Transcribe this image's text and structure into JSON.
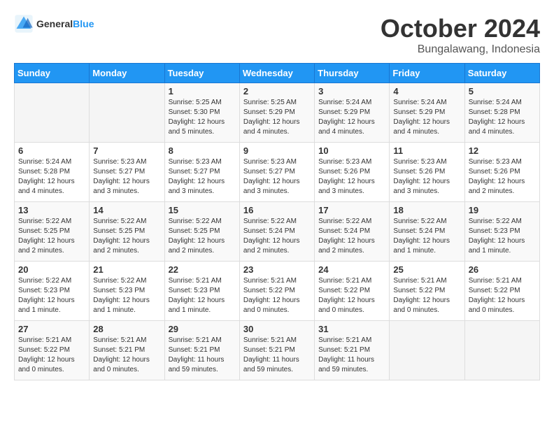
{
  "header": {
    "logo_general": "General",
    "logo_blue": "Blue",
    "month_title": "October 2024",
    "location": "Bungalawang, Indonesia"
  },
  "calendar": {
    "days_of_week": [
      "Sunday",
      "Monday",
      "Tuesday",
      "Wednesday",
      "Thursday",
      "Friday",
      "Saturday"
    ],
    "weeks": [
      [
        {
          "day": "",
          "content": ""
        },
        {
          "day": "",
          "content": ""
        },
        {
          "day": "1",
          "content": "Sunrise: 5:25 AM\nSunset: 5:30 PM\nDaylight: 12 hours\nand 5 minutes."
        },
        {
          "day": "2",
          "content": "Sunrise: 5:25 AM\nSunset: 5:29 PM\nDaylight: 12 hours\nand 4 minutes."
        },
        {
          "day": "3",
          "content": "Sunrise: 5:24 AM\nSunset: 5:29 PM\nDaylight: 12 hours\nand 4 minutes."
        },
        {
          "day": "4",
          "content": "Sunrise: 5:24 AM\nSunset: 5:29 PM\nDaylight: 12 hours\nand 4 minutes."
        },
        {
          "day": "5",
          "content": "Sunrise: 5:24 AM\nSunset: 5:28 PM\nDaylight: 12 hours\nand 4 minutes."
        }
      ],
      [
        {
          "day": "6",
          "content": "Sunrise: 5:24 AM\nSunset: 5:28 PM\nDaylight: 12 hours\nand 4 minutes."
        },
        {
          "day": "7",
          "content": "Sunrise: 5:23 AM\nSunset: 5:27 PM\nDaylight: 12 hours\nand 3 minutes."
        },
        {
          "day": "8",
          "content": "Sunrise: 5:23 AM\nSunset: 5:27 PM\nDaylight: 12 hours\nand 3 minutes."
        },
        {
          "day": "9",
          "content": "Sunrise: 5:23 AM\nSunset: 5:27 PM\nDaylight: 12 hours\nand 3 minutes."
        },
        {
          "day": "10",
          "content": "Sunrise: 5:23 AM\nSunset: 5:26 PM\nDaylight: 12 hours\nand 3 minutes."
        },
        {
          "day": "11",
          "content": "Sunrise: 5:23 AM\nSunset: 5:26 PM\nDaylight: 12 hours\nand 3 minutes."
        },
        {
          "day": "12",
          "content": "Sunrise: 5:23 AM\nSunset: 5:26 PM\nDaylight: 12 hours\nand 2 minutes."
        }
      ],
      [
        {
          "day": "13",
          "content": "Sunrise: 5:22 AM\nSunset: 5:25 PM\nDaylight: 12 hours\nand 2 minutes."
        },
        {
          "day": "14",
          "content": "Sunrise: 5:22 AM\nSunset: 5:25 PM\nDaylight: 12 hours\nand 2 minutes."
        },
        {
          "day": "15",
          "content": "Sunrise: 5:22 AM\nSunset: 5:25 PM\nDaylight: 12 hours\nand 2 minutes."
        },
        {
          "day": "16",
          "content": "Sunrise: 5:22 AM\nSunset: 5:24 PM\nDaylight: 12 hours\nand 2 minutes."
        },
        {
          "day": "17",
          "content": "Sunrise: 5:22 AM\nSunset: 5:24 PM\nDaylight: 12 hours\nand 2 minutes."
        },
        {
          "day": "18",
          "content": "Sunrise: 5:22 AM\nSunset: 5:24 PM\nDaylight: 12 hours\nand 1 minute."
        },
        {
          "day": "19",
          "content": "Sunrise: 5:22 AM\nSunset: 5:23 PM\nDaylight: 12 hours\nand 1 minute."
        }
      ],
      [
        {
          "day": "20",
          "content": "Sunrise: 5:22 AM\nSunset: 5:23 PM\nDaylight: 12 hours\nand 1 minute."
        },
        {
          "day": "21",
          "content": "Sunrise: 5:22 AM\nSunset: 5:23 PM\nDaylight: 12 hours\nand 1 minute."
        },
        {
          "day": "22",
          "content": "Sunrise: 5:21 AM\nSunset: 5:23 PM\nDaylight: 12 hours\nand 1 minute."
        },
        {
          "day": "23",
          "content": "Sunrise: 5:21 AM\nSunset: 5:22 PM\nDaylight: 12 hours\nand 0 minutes."
        },
        {
          "day": "24",
          "content": "Sunrise: 5:21 AM\nSunset: 5:22 PM\nDaylight: 12 hours\nand 0 minutes."
        },
        {
          "day": "25",
          "content": "Sunrise: 5:21 AM\nSunset: 5:22 PM\nDaylight: 12 hours\nand 0 minutes."
        },
        {
          "day": "26",
          "content": "Sunrise: 5:21 AM\nSunset: 5:22 PM\nDaylight: 12 hours\nand 0 minutes."
        }
      ],
      [
        {
          "day": "27",
          "content": "Sunrise: 5:21 AM\nSunset: 5:22 PM\nDaylight: 12 hours\nand 0 minutes."
        },
        {
          "day": "28",
          "content": "Sunrise: 5:21 AM\nSunset: 5:21 PM\nDaylight: 12 hours\nand 0 minutes."
        },
        {
          "day": "29",
          "content": "Sunrise: 5:21 AM\nSunset: 5:21 PM\nDaylight: 11 hours\nand 59 minutes."
        },
        {
          "day": "30",
          "content": "Sunrise: 5:21 AM\nSunset: 5:21 PM\nDaylight: 11 hours\nand 59 minutes."
        },
        {
          "day": "31",
          "content": "Sunrise: 5:21 AM\nSunset: 5:21 PM\nDaylight: 11 hours\nand 59 minutes."
        },
        {
          "day": "",
          "content": ""
        },
        {
          "day": "",
          "content": ""
        }
      ]
    ]
  }
}
